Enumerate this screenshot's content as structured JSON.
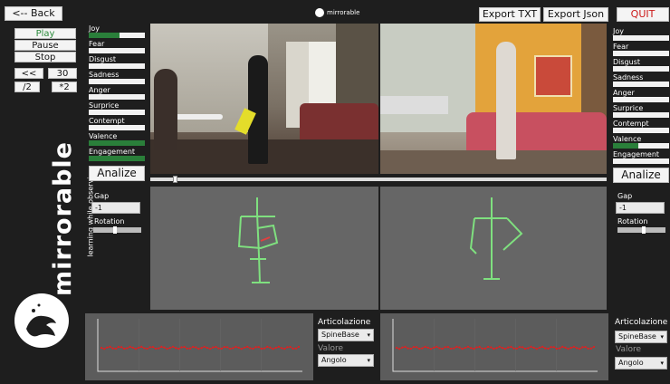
{
  "header": {
    "back_label": "<-- Back",
    "export_txt": "Export TXT",
    "export_json": "Export Json",
    "quit": "QUIT",
    "logo_text": "mirrorable"
  },
  "controls": {
    "play": "Play",
    "pause": "Pause",
    "stop": "Stop",
    "rewind": "<< 30",
    "forward": "30 >>",
    "half": "/2",
    "double": "*2"
  },
  "emotions": [
    {
      "label": "Joy",
      "left": 0.55,
      "right": 0
    },
    {
      "label": "Fear",
      "left": 0,
      "right": 0
    },
    {
      "label": "Disgust",
      "left": 0,
      "right": 0
    },
    {
      "label": "Sadness",
      "left": 0,
      "right": 0
    },
    {
      "label": "Anger",
      "left": 0,
      "right": 0
    },
    {
      "label": "Surprice",
      "left": 0,
      "right": 0
    },
    {
      "label": "Contempt",
      "left": 0,
      "right": 0
    },
    {
      "label": "Valence",
      "left": 1,
      "right": 0.45
    },
    {
      "label": "Engagement",
      "left": 1,
      "right": 0
    }
  ],
  "analize": "Analize",
  "gap_label": "Gap",
  "gap_left": "-1",
  "gap_right": "-1",
  "rotation_label": "Rotation",
  "rotation_left": 0.45,
  "rotation_right": 0.55,
  "brand": {
    "name": "mirrorable",
    "tagline": "learning while observing"
  },
  "articolazione_label": "Articolazione",
  "articolazione_value": "SpineBase",
  "valore_label": "Valore",
  "valore_value": "Angolo",
  "timeline_progress": 0.05,
  "colors": {
    "accent_green": "#2a7f3a",
    "quit_red": "#cc1a1a",
    "skeleton": "#7fe07f",
    "series": "#d22"
  }
}
